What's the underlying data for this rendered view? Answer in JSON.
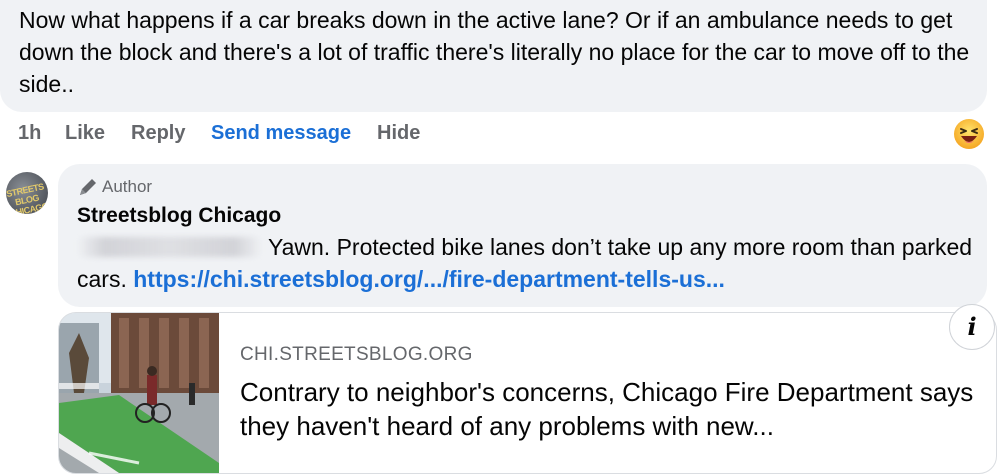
{
  "comment": {
    "text": "Now what happens if a car breaks down in the active lane? Or if an ambulance needs to get down the block and there's a lot of traffic there's literally no place for the car to move off to the side..",
    "time": "1h",
    "like_label": "Like",
    "reply_label": "Reply",
    "send_message_label": "Send message",
    "hide_label": "Hide",
    "reaction_icon": "laughing-emoji-icon"
  },
  "reply": {
    "avatar_text": "STREETS BLOG CHICAGO",
    "badge_label": "Author",
    "author_name": "Streetsblog Chicago",
    "text": "Yawn. Protected bike lanes don’t take up any more room than parked cars.",
    "link_text": "https://chi.streetsblog.org/.../fire-department-tells-us...",
    "link_color": "#1b6fd6"
  },
  "link_card": {
    "domain": "CHI.STREETSBLOG.ORG",
    "headline": "Contrary to neighbor's concerns, Chicago Fire Department says they haven't heard of any problems with new...",
    "info_label": "i",
    "thumbnail": "street-with-green-bike-lane-image"
  }
}
